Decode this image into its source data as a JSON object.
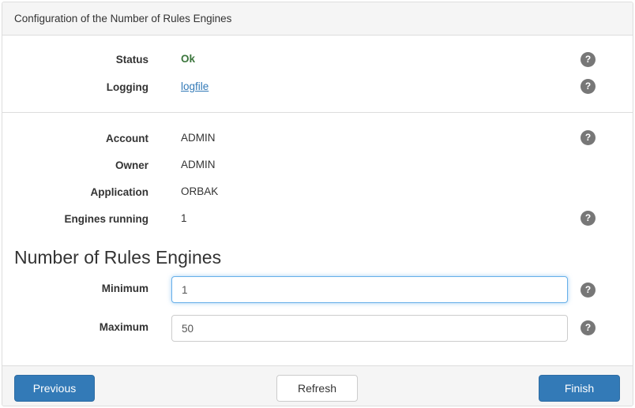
{
  "panel": {
    "title": "Configuration of the Number of Rules Engines"
  },
  "info_rows": [
    {
      "label": "Status",
      "value": "Ok"
    },
    {
      "label": "Logging",
      "value": "logfile"
    }
  ],
  "detail_rows": [
    {
      "label": "Account",
      "value": "ADMIN"
    },
    {
      "label": "Owner",
      "value": "ADMIN"
    },
    {
      "label": "Application",
      "value": "ORBAK"
    },
    {
      "label": "Engines running",
      "value": "1"
    }
  ],
  "engines_section": {
    "title": "Number of Rules Engines",
    "minimum_label": "Minimum",
    "minimum_value": "1",
    "maximum_label": "Maximum",
    "maximum_value": "50"
  },
  "help_glyph": "?",
  "footer": {
    "previous_label": "Previous",
    "refresh_label": "Refresh",
    "finish_label": "Finish"
  },
  "colors": {
    "primary": "#337ab7",
    "status_ok": "#3c763d",
    "help_badge": "#777777",
    "focus_border": "#66afe9"
  }
}
